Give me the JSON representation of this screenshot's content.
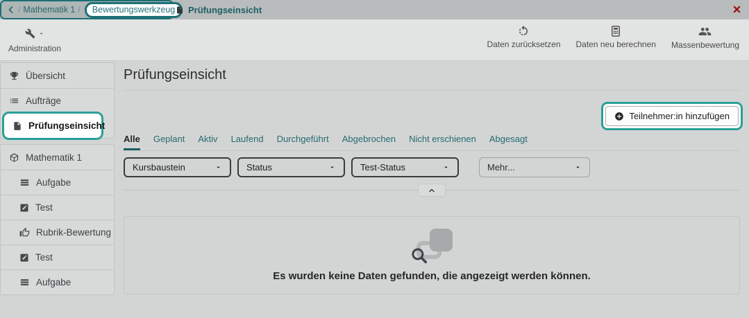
{
  "topbar": {
    "separator": "/",
    "breadcrumb_course": "Mathematik 1",
    "breadcrumb_highlighted": "Bewertungswerkzeug",
    "active_tab": "Prüfungseinsicht"
  },
  "toolbar": {
    "admin_label": "Administration",
    "actions": [
      {
        "label": "Daten zurücksetzen",
        "icon": "undo-icon"
      },
      {
        "label": "Daten neu berechnen",
        "icon": "calculator-icon"
      },
      {
        "label": "Massenbewertung",
        "icon": "group-icon"
      }
    ]
  },
  "sidebar": {
    "group1": [
      {
        "label": "Übersicht",
        "icon": "trophy-icon"
      },
      {
        "label": "Aufträge",
        "icon": "list-icon"
      },
      {
        "label": "Prüfungseinsicht",
        "icon": "document-icon",
        "highlighted": true
      }
    ],
    "group2": [
      {
        "label": "Mathematik 1",
        "icon": "cube-icon"
      },
      {
        "label": "Aufgabe",
        "icon": "stack-icon"
      },
      {
        "label": "Test",
        "icon": "edit-icon"
      },
      {
        "label": "Rubrik-Bewertung",
        "icon": "thumb-up-icon"
      },
      {
        "label": "Test",
        "icon": "edit-icon"
      },
      {
        "label": "Aufgabe",
        "icon": "stack-icon"
      }
    ]
  },
  "main": {
    "title": "Prüfungseinsicht",
    "add_button": "Teilnehmer:in hinzufügen",
    "tabs": [
      {
        "label": "Alle",
        "active": true
      },
      {
        "label": "Geplant"
      },
      {
        "label": "Aktiv"
      },
      {
        "label": "Laufend"
      },
      {
        "label": "Durchgeführt"
      },
      {
        "label": "Abgebrochen"
      },
      {
        "label": "Nicht erschienen"
      },
      {
        "label": "Abgesagt"
      }
    ],
    "filters": [
      {
        "label": "Kursbaustein"
      },
      {
        "label": "Status"
      },
      {
        "label": "Test-Status"
      }
    ],
    "more_filter": "Mehr...",
    "empty_message": "Es wurden keine Daten gefunden, die angezeigt werden können."
  },
  "colors": {
    "annotation_teal": "#2aa096",
    "breadcrumb_teal": "#1d6f74",
    "close_red": "#9e1117",
    "topbar_gray": "#b9bcbc",
    "page_gray": "#d3d5d5"
  }
}
